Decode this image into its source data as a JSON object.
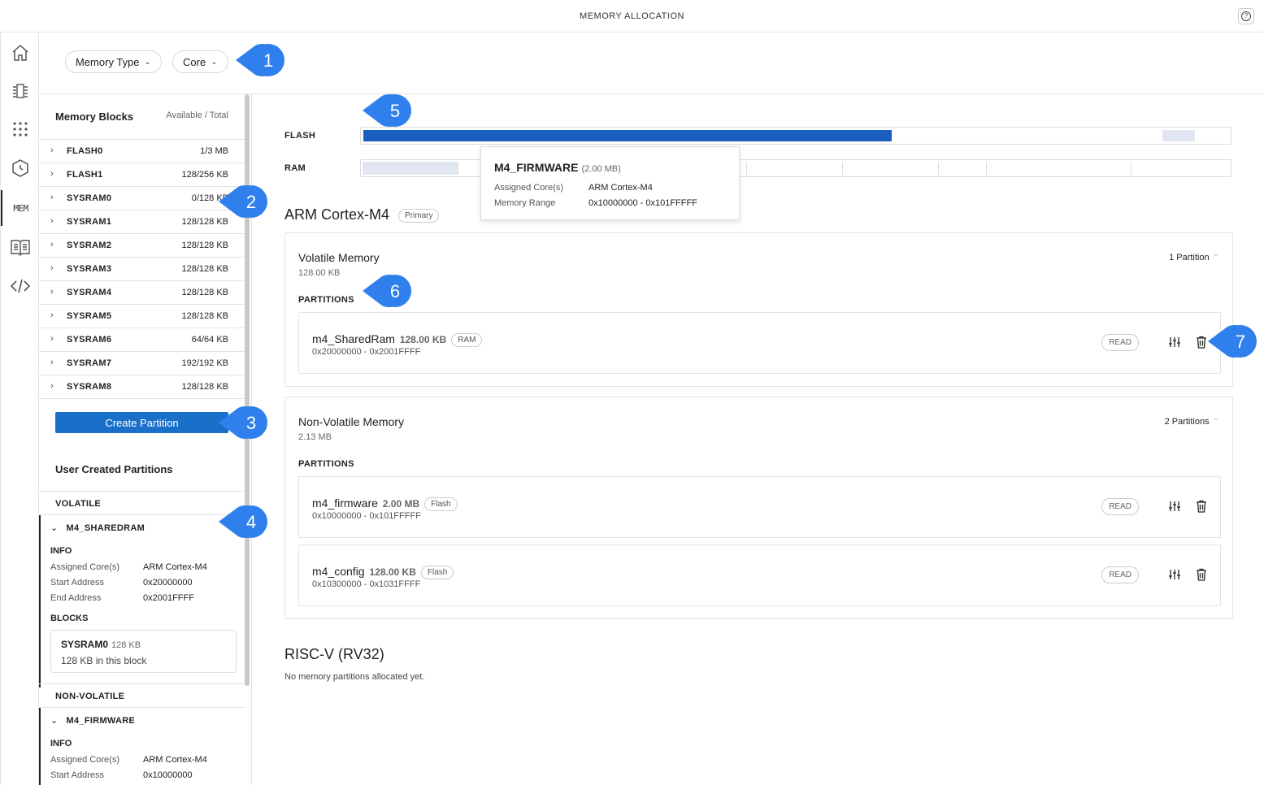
{
  "window": {
    "title": "MEMORY ALLOCATION",
    "help_icon": "?"
  },
  "rail": {
    "mem_label": "MEM"
  },
  "filters": [
    {
      "label": "Memory Type"
    },
    {
      "label": "Core"
    }
  ],
  "left_panel": {
    "title": "Memory Blocks",
    "subtitle": "Available / Total",
    "blocks": [
      {
        "name": "FLASH0",
        "value": "1/3 MB"
      },
      {
        "name": "FLASH1",
        "value": "128/256 KB"
      },
      {
        "name": "SYSRAM0",
        "value": "0/128 KB"
      },
      {
        "name": "SYSRAM1",
        "value": "128/128 KB"
      },
      {
        "name": "SYSRAM2",
        "value": "128/128 KB"
      },
      {
        "name": "SYSRAM3",
        "value": "128/128 KB"
      },
      {
        "name": "SYSRAM4",
        "value": "128/128 KB"
      },
      {
        "name": "SYSRAM5",
        "value": "128/128 KB"
      },
      {
        "name": "SYSRAM6",
        "value": "64/64 KB"
      },
      {
        "name": "SYSRAM7",
        "value": "192/192 KB"
      },
      {
        "name": "SYSRAM8",
        "value": "128/128 KB"
      }
    ],
    "create_button": "Create Partition",
    "user_partitions_title": "User Created Partitions",
    "volatile_label": "VOLATILE",
    "nonvolatile_label": "NON-VOLATILE",
    "partitions": [
      {
        "name": "M4_SHAREDRAM",
        "info_label": "INFO",
        "core_key": "Assigned Core(s)",
        "core_val": "ARM Cortex-M4",
        "start_key": "Start Address",
        "start_val": "0x20000000",
        "end_key": "End Address",
        "end_val": "0x2001FFFF",
        "blocks_label": "BLOCKS",
        "block_name": "SYSRAM0",
        "block_size": "128 KB",
        "block_note": "128 KB in this block"
      },
      {
        "name": "M4_FIRMWARE",
        "info_label": "INFO",
        "core_key": "Assigned Core(s)",
        "core_val": "ARM Cortex-M4",
        "start_key": "Start Address",
        "start_val": "0x10000000"
      }
    ]
  },
  "usage_bars": {
    "flash_label": "FLASH",
    "ram_label": "RAM",
    "flash_used_fraction": 0.61
  },
  "tooltip": {
    "name": "M4_FIRMWARE",
    "size": "(2.00 MB)",
    "core_key": "Assigned Core(s)",
    "core_val": "ARM Cortex-M4",
    "range_key": "Memory Range",
    "range_val": "0x10000000 - 0x101FFFFF"
  },
  "cores": [
    {
      "title": "ARM Cortex-M4",
      "tag": "Primary",
      "sections": [
        {
          "title": "Volatile Memory",
          "size": "128.00 KB",
          "count": "1 Partition",
          "partitions_label": "PARTITIONS",
          "partitions": [
            {
              "name": "m4_SharedRam",
              "size": "128.00 KB",
              "type": "RAM",
              "range": "0x20000000 - 0x2001FFFF",
              "access": "READ"
            }
          ]
        },
        {
          "title": "Non-Volatile Memory",
          "size": "2.13 MB",
          "count": "2 Partitions",
          "partitions_label": "PARTITIONS",
          "partitions": [
            {
              "name": "m4_firmware",
              "size": "2.00 MB",
              "type": "Flash",
              "range": "0x10000000 - 0x101FFFFF",
              "access": "READ"
            },
            {
              "name": "m4_config",
              "size": "128.00 KB",
              "type": "Flash",
              "range": "0x10300000 - 0x1031FFFF",
              "access": "READ"
            }
          ]
        }
      ]
    },
    {
      "title": "RISC-V (RV32)",
      "empty": "No memory partitions allocated yet."
    }
  ],
  "callouts": [
    "1",
    "2",
    "3",
    "4",
    "5",
    "6",
    "7"
  ],
  "colors": {
    "accent": "#1a6fc9",
    "callout": "#2f80ed",
    "flash_fill": "#1a5fbf"
  }
}
